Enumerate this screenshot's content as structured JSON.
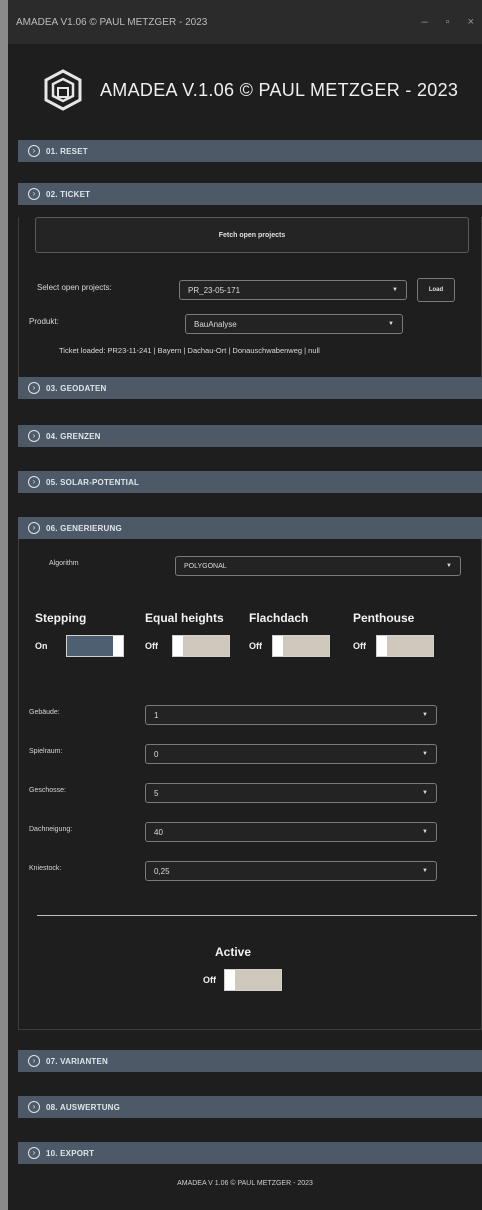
{
  "window": {
    "title": "AMADEA V1.06 © PAUL METZGER - 2023",
    "controls": [
      "–",
      "▫",
      "×"
    ]
  },
  "header": {
    "title": "AMADEA V.1.06 © PAUL METZGER -  2023"
  },
  "sections": {
    "s01": "01. RESET",
    "s02": "02. TICKET",
    "s03": "03. GEODATEN",
    "s04": "04. GRENZEN",
    "s05": "05. SOLAR-POTENTIAL",
    "s06": "06. GENERIERUNG",
    "s07": "07. VARIANTEN",
    "s08": "08. AUSWERTUNG",
    "s10": "10. EXPORT"
  },
  "ticket": {
    "fetch_label": "Fetch open projects",
    "select_label": "Select open projects:",
    "project_value": "PR_23-05-171",
    "load_label": "Load",
    "produkt_label": "Produkt:",
    "produkt_value": "BauAnalyse",
    "ticket_loaded": "Ticket loaded: PR23-11-241 | Bayern | Dachau-Ort | Donauschwabenweg | null"
  },
  "generierung": {
    "algorithm_label": "Algorithm",
    "algorithm_value": "POLYGONAL",
    "toggles": [
      {
        "label": "Stepping",
        "state": "On"
      },
      {
        "label": "Equal heights",
        "state": "Off"
      },
      {
        "label": "Flachdach",
        "state": "Off"
      },
      {
        "label": "Penthouse",
        "state": "Off"
      }
    ],
    "fields": [
      {
        "label": "Gebäude:",
        "value": "1"
      },
      {
        "label": "Spielraum:",
        "value": "0"
      },
      {
        "label": "Geschosse:",
        "value": "5"
      },
      {
        "label": "Dachneigung:",
        "value": "40"
      },
      {
        "label": "Kniestock:",
        "value": "0,25"
      }
    ],
    "active_label": "Active",
    "active_state": "Off"
  },
  "footer": {
    "text": "AMADEA V 1.06 © PAUL METZGER - 2023"
  },
  "colors": {
    "section_bar": "#4d5966",
    "background": "#1e1e1e",
    "switch_off": "#cfc9bd",
    "switch_on": "#4e5f72"
  }
}
